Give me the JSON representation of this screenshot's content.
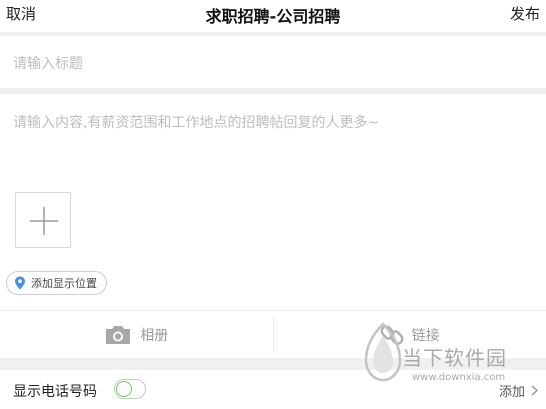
{
  "header": {
    "cancel_label": "取消",
    "title": "求职招聘-公司招聘",
    "publish_label": "发布"
  },
  "form": {
    "title_placeholder": "请输入标题",
    "content_placeholder": "请输入内容,有薪资范围和工作地点的招聘帖回复的人更多~",
    "location_label": "添加显示位置"
  },
  "media": {
    "album_label": "相册",
    "link_label": "链接"
  },
  "phone": {
    "label": "显示电话号码",
    "toggle_on": false,
    "add_label": "添加"
  },
  "watermark": {
    "name": "当下软件园",
    "url": "www.downxia.com"
  },
  "colors": {
    "accent_pin": "#4a90e2",
    "toggle_border": "#6fcf5f",
    "placeholder": "#bdbdbd"
  },
  "icons": [
    "plus-icon",
    "location-pin-icon",
    "camera-icon",
    "link-icon",
    "chevron-right-icon"
  ]
}
